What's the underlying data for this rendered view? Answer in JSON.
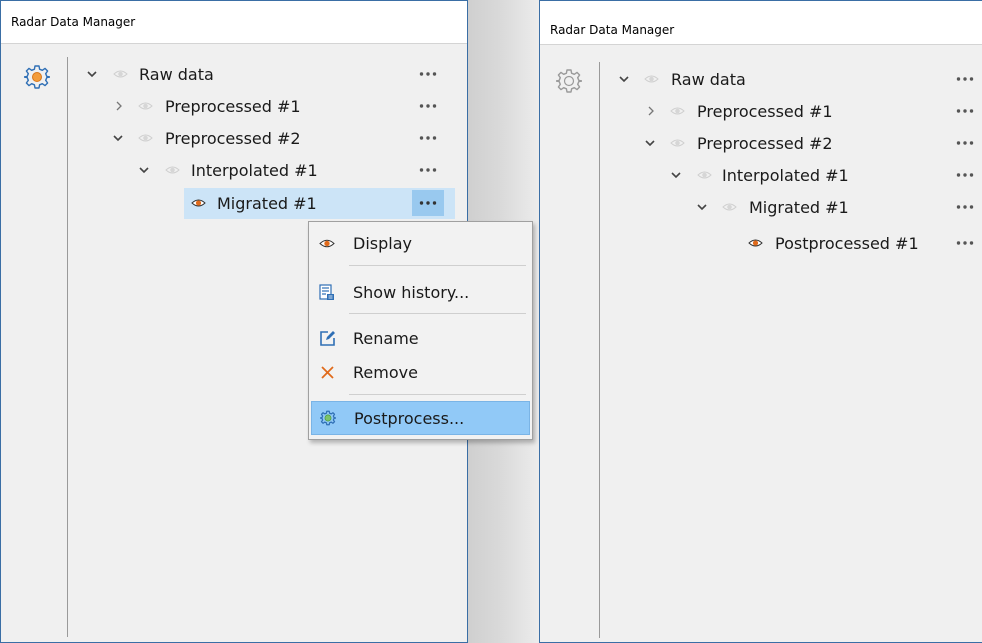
{
  "left_panel": {
    "title": "Radar Data Manager",
    "tree": [
      {
        "label": "Raw data",
        "expanded": true,
        "visible": false
      },
      {
        "label": "Preprocessed #1",
        "expanded": false,
        "visible": false
      },
      {
        "label": "Preprocessed #2",
        "expanded": true,
        "visible": false
      },
      {
        "label": "Interpolated #1",
        "expanded": true,
        "visible": false
      },
      {
        "label": "Migrated #1",
        "selected": true,
        "visible": true
      }
    ],
    "context_menu": {
      "items": [
        {
          "label": "Display",
          "icon": "eye-icon"
        },
        {
          "label": "Show history...",
          "icon": "history-icon"
        },
        {
          "label": "Rename",
          "icon": "rename-icon"
        },
        {
          "label": "Remove",
          "icon": "remove-icon"
        },
        {
          "label": "Postprocess...",
          "icon": "postprocess-icon",
          "highlighted": true
        }
      ]
    }
  },
  "right_panel": {
    "title": "Radar Data Manager",
    "tree": [
      {
        "label": "Raw data",
        "expanded": true,
        "visible": false
      },
      {
        "label": "Preprocessed #1",
        "expanded": false,
        "visible": false
      },
      {
        "label": "Preprocessed #2",
        "expanded": true,
        "visible": false
      },
      {
        "label": "Interpolated #1",
        "expanded": true,
        "visible": false
      },
      {
        "label": "Migrated #1",
        "expanded": true,
        "visible": false
      },
      {
        "label": "Postprocessed #1",
        "visible": true
      }
    ]
  },
  "colors": {
    "accent_orange": "#e06a1b",
    "selection": "#cce4f7",
    "menu_highlight": "#91c9f7",
    "icon_blue": "#2f6fb5",
    "panel_bg": "#f0f0f0"
  }
}
